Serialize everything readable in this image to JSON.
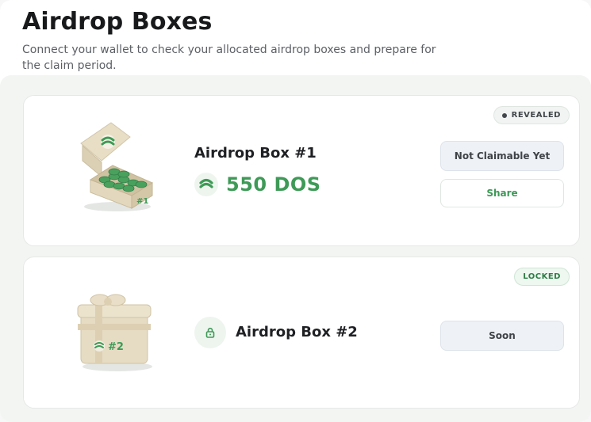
{
  "header": {
    "title": "Airdrop Boxes",
    "subtitle": "Connect your wallet to check your allocated airdrop boxes and prepare for the claim period."
  },
  "boxes": [
    {
      "name": "Airdrop Box #1",
      "status": "REVEALED",
      "amount": "550 DOS",
      "box_label": "#1",
      "primary_button": "Not Claimable Yet",
      "secondary_button": "Share"
    },
    {
      "name": "Airdrop Box #2",
      "status": "LOCKED",
      "box_label": "#2",
      "primary_button": "Soon"
    }
  ],
  "colors": {
    "accent_green": "#3e9a57",
    "box_beige": "#e6dcc4",
    "button_disabled_bg": "#eef2f6"
  },
  "icons": {
    "token": "dos-token-icon",
    "lock": "lock-icon",
    "status_dot": "status-dot-icon"
  }
}
